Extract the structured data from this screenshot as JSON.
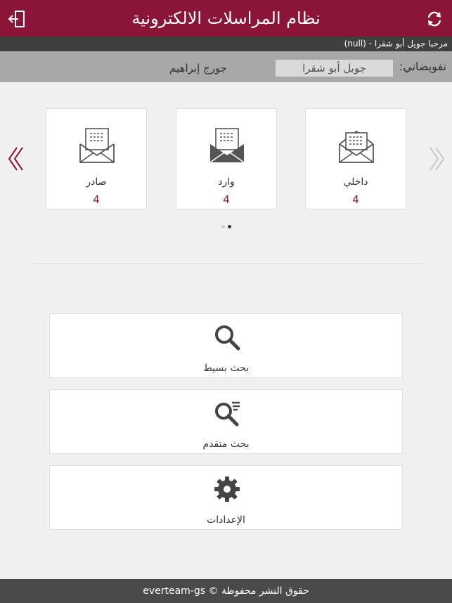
{
  "header": {
    "title": "نظام المراسلات الالكترونية",
    "exit_icon": "exit-icon",
    "refresh_icon": "refresh-icon"
  },
  "welcome": {
    "text": "مرحبا جويل أبو شقرا - (null)"
  },
  "delegation": {
    "label": "تفويضاتي:",
    "selected": "جويل أبو شقرا",
    "other": "جورج إبراهيم"
  },
  "cards": [
    {
      "label": "داخلي",
      "count": "4",
      "icon": "open-envelope-icon"
    },
    {
      "label": "وارد",
      "count": "4",
      "icon": "incoming-envelope-icon"
    },
    {
      "label": "صادر",
      "count": "4",
      "icon": "outgoing-envelope-icon"
    }
  ],
  "pager": {
    "pages": 2,
    "active": 2
  },
  "actions": [
    {
      "label": "بحث بسيط",
      "icon": "search-icon"
    },
    {
      "label": "بحث متقدم",
      "icon": "advanced-search-icon"
    },
    {
      "label": "الإعدادات",
      "icon": "gear-icon"
    }
  ],
  "footer": {
    "text": "حقوق النشر محفوظة © everteam-gs"
  },
  "colors": {
    "brand": "#8a1538",
    "dark_bar": "#3f3f3f",
    "gray_bar": "#a8a8a8",
    "footer": "#4a4a4a"
  }
}
